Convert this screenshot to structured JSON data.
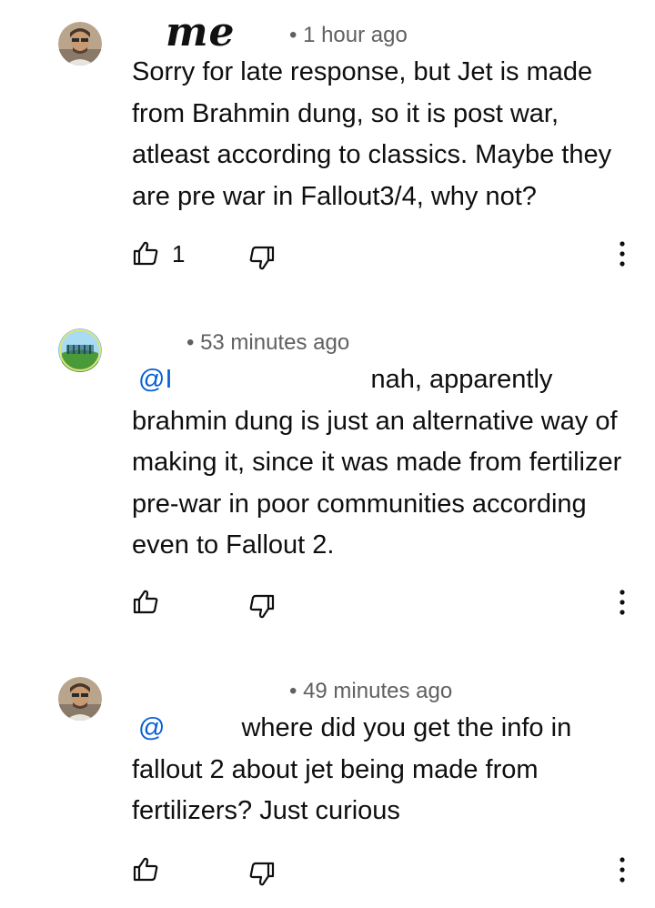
{
  "comments": [
    {
      "author_handwritten": "me",
      "time": "• 1 hour ago",
      "text": "Sorry for late response, but Jet is made from Brahmin dung, so it is post war, atleast according to classics. Maybe they are pre war in Fallout3/4, why not?",
      "likes": "1",
      "avatar_icon": "user-avatar-icon",
      "like_icon": "thumbs-up-icon",
      "dislike_icon": "thumbs-down-icon",
      "more_icon": "more-vertical-icon"
    },
    {
      "time": "• 53 minutes ago",
      "mention": "@I",
      "text_line1": "nah, apparently",
      "text_rest": "brahmin dung is just an alternative way of making it, since it was made from fertilizer pre-war in poor communities according even to Fallout 2.",
      "avatar_icon": "landscape-avatar-icon",
      "like_icon": "thumbs-up-icon",
      "dislike_icon": "thumbs-down-icon",
      "more_icon": "more-vertical-icon"
    },
    {
      "time": "• 49 minutes ago",
      "mention": "@",
      "text_line1": "where did you get the info in",
      "text_rest": "fallout 2 about jet being made from fertilizers? Just curious",
      "avatar_icon": "user-avatar-icon",
      "like_icon": "thumbs-up-icon",
      "dislike_icon": "thumbs-down-icon",
      "more_icon": "more-vertical-icon"
    }
  ],
  "colors": {
    "mention": "#065fd4",
    "meta": "#606060",
    "text": "#0f0f0f"
  }
}
